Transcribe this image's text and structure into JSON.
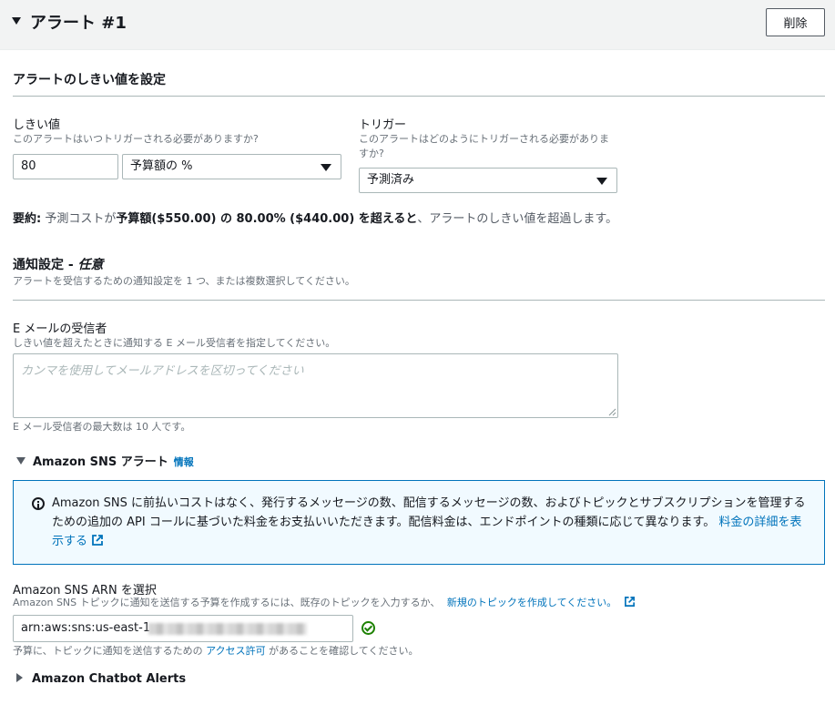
{
  "header": {
    "title": "アラート #1",
    "delete_label": "削除"
  },
  "threshold_section": {
    "title": "アラートのしきい値を設定"
  },
  "threshold": {
    "label": "しきい値",
    "description": "このアラートはいつトリガーされる必要がありますか?",
    "value": "80",
    "unit_selected": "予算額の %"
  },
  "trigger": {
    "label": "トリガー",
    "description_line1": "このアラートはどのようにトリガーされる必要がありま",
    "description_line2": "すか?",
    "selected": "予測済み"
  },
  "summary": {
    "prefix": "要約:",
    "part1": " 予測コストが",
    "bold1": "予算額($550.00) の 80.00% ($440.00) を超えると",
    "part2": "、アラートのしきい値を超過します。"
  },
  "notification": {
    "title": "通知設定 - ",
    "title_optional": "任意",
    "description": "アラートを受信するための通知設定を 1 つ、または複数選択してください。"
  },
  "email": {
    "label": "E メールの受信者",
    "description": "しきい値を超えたときに通知する E メール受信者を指定してください。",
    "placeholder": "カンマを使用してメールアドレスを区切ってください",
    "max_note": "E メール受信者の最大数は 10 人です。"
  },
  "sns": {
    "expander_label": "Amazon SNS アラート",
    "info_label": "情報",
    "info_text_line1": "Amazon SNS に前払いコストはなく、発行するメッセージの数、配信するメッセージの数、およびトピックとサブスクリプションを管理する",
    "info_text_line2": "ための追加の API コールに基づいた料金をお支払いいただきます。配信料金は、エンドポイントの種類に応じて異なります。",
    "pricing_link_line2": "料金の詳細を表",
    "pricing_link_line3": "示する",
    "arn_label": "Amazon SNS ARN を選択",
    "arn_description": "Amazon SNS トピックに通知を送信する予算を作成するには、既存のトピックを入力するか、",
    "arn_create_link": "新規のトピックを作成してください。",
    "arn_value": "arn:aws:sns:us-east-1",
    "permission_prefix": "予算に、トピックに通知を送信するための",
    "permission_link": "アクセス許可",
    "permission_suffix": "があることを確認してください。"
  },
  "chatbot": {
    "expander_label": "Amazon Chatbot Alerts"
  },
  "colors": {
    "link": "#0073bb",
    "info_bg": "#f1faff",
    "success": "#1d8102"
  }
}
